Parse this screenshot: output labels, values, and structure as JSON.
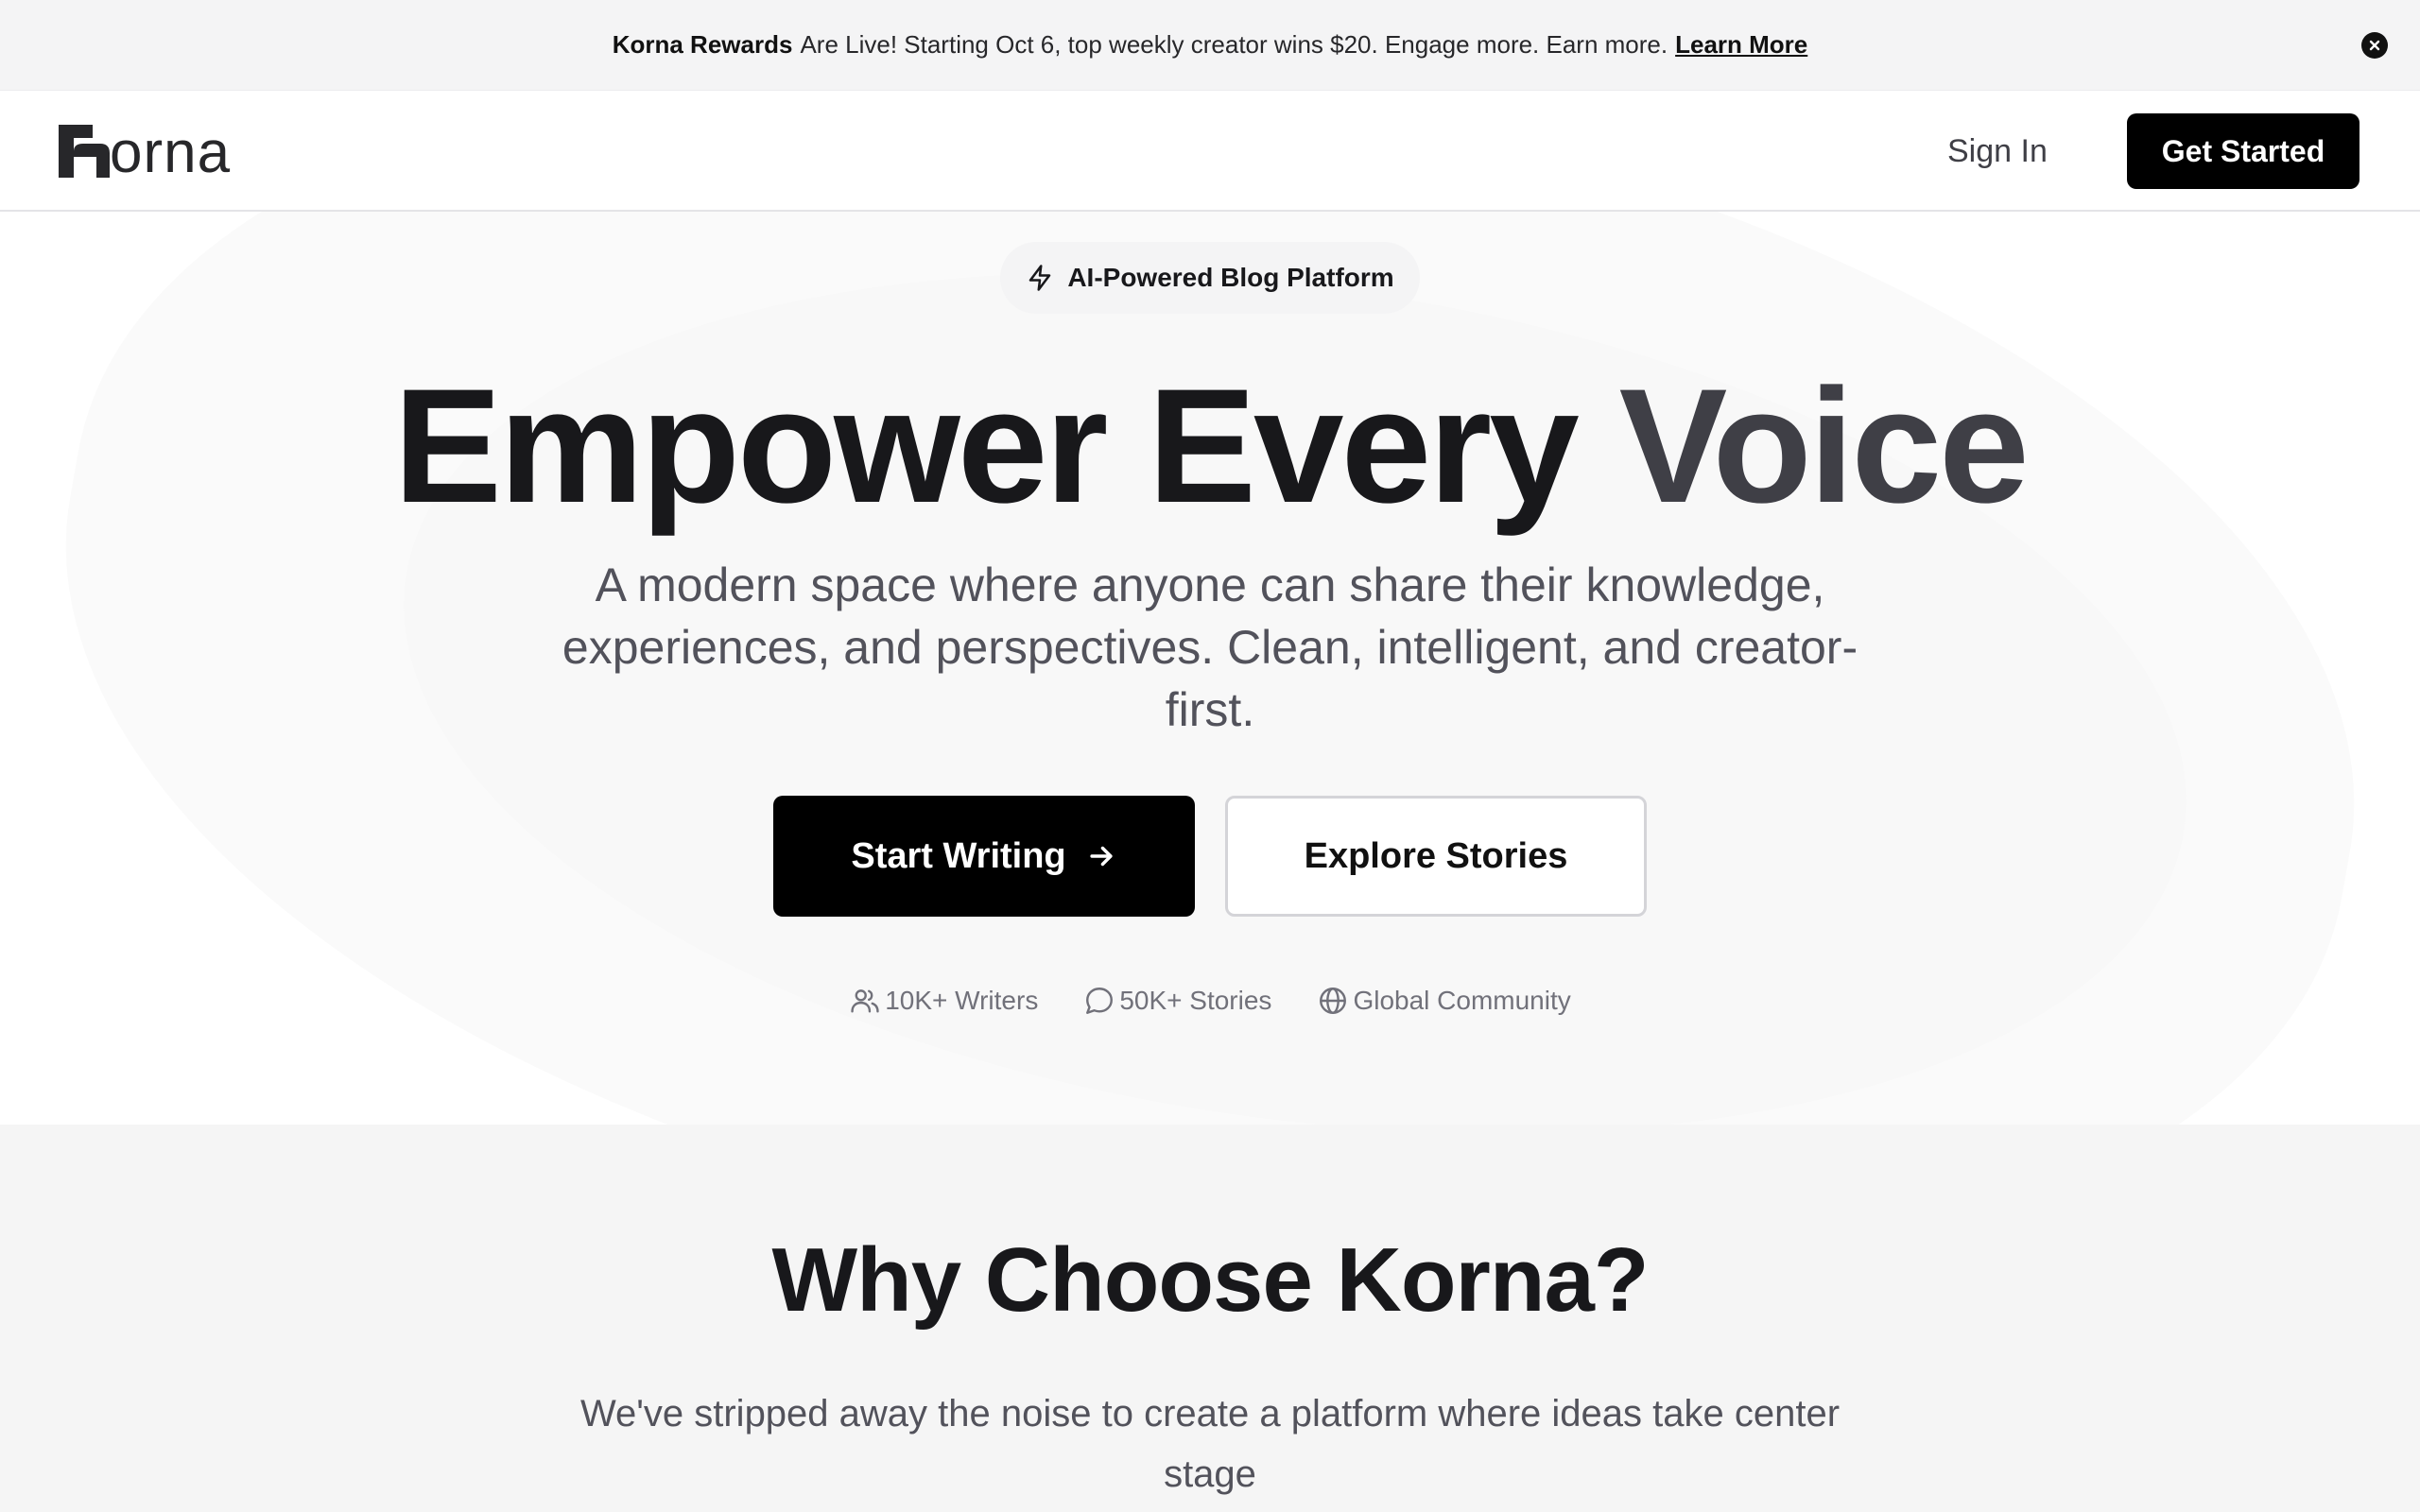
{
  "announcement": {
    "brand": "Korna Rewards",
    "message": "Are Live! Starting Oct 6, top weekly creator wins $20. Engage more. Earn more.",
    "link": "Learn More"
  },
  "nav": {
    "logo_rest": "orna",
    "sign_in": "Sign In",
    "get_started": "Get Started"
  },
  "hero": {
    "badge": "AI-Powered Blog Platform",
    "headline_part1": "Empower Every",
    "headline_part2": "Voice",
    "subtitle": "A modern space where anyone can share their knowledge, experiences, and perspectives. Clean, intelligent, and creator-first.",
    "primary_button": "Start Writing",
    "secondary_button": "Explore Stories",
    "stats": [
      {
        "icon": "users-icon",
        "label": "10K+ Writers"
      },
      {
        "icon": "message-circle-icon",
        "label": "50K+ Stories"
      },
      {
        "icon": "globe-icon",
        "label": "Global Community"
      }
    ]
  },
  "why": {
    "title": "Why Choose Korna?",
    "subtitle": "We've stripped away the noise to create a platform where ideas take center stage"
  },
  "colors": {
    "primary": "#000000",
    "headline_dark": "#18181b",
    "headline_accent": "#3f3f46",
    "muted": "#71717a"
  }
}
